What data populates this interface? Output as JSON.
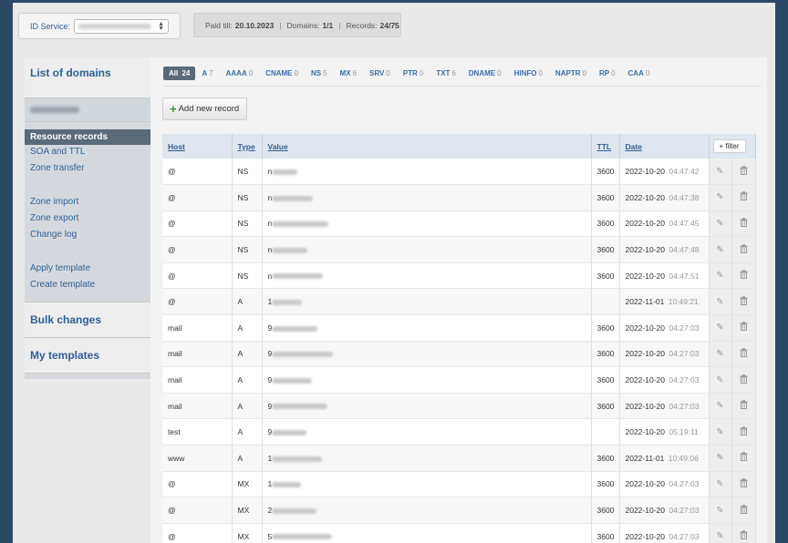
{
  "topbar": {
    "id_service_label": "ID Service:",
    "info": {
      "paid_till_label": "Paid till:",
      "paid_till_value": "20.10.2023",
      "domains_label": "Domains:",
      "domains_value": "1/1",
      "records_label": "Records:",
      "records_value": "24/75"
    }
  },
  "sidebar": {
    "list_of_domains": "List of domains",
    "active_item": "Resource records",
    "menu_group1": [
      "SOA and TTL",
      "Zone transfer"
    ],
    "menu_group2": [
      "Zone import",
      "Zone export",
      "Change log"
    ],
    "menu_group3": [
      "Apply template",
      "Create template"
    ],
    "bulk_changes": "Bulk changes",
    "my_templates": "My templates"
  },
  "filters": [
    {
      "label": "All",
      "count": "24",
      "active": true
    },
    {
      "label": "A",
      "count": "7"
    },
    {
      "label": "AAAA",
      "count": "0"
    },
    {
      "label": "CNAME",
      "count": "0"
    },
    {
      "label": "NS",
      "count": "5"
    },
    {
      "label": "MX",
      "count": "6"
    },
    {
      "label": "SRV",
      "count": "0"
    },
    {
      "label": "PTR",
      "count": "0"
    },
    {
      "label": "TXT",
      "count": "6"
    },
    {
      "label": "DNAME",
      "count": "0"
    },
    {
      "label": "HINFO",
      "count": "0"
    },
    {
      "label": "NAPTR",
      "count": "0"
    },
    {
      "label": "RP",
      "count": "0"
    },
    {
      "label": "CAA",
      "count": "0"
    }
  ],
  "add_record_label": "Add new record",
  "table": {
    "headers": {
      "host": "Host",
      "type": "Type",
      "value": "Value",
      "ttl": "TTL",
      "date": "Date",
      "filter": "+ filter"
    },
    "rows": [
      {
        "host": "@",
        "type": "NS",
        "value_prefix": "n",
        "ttl": "3600",
        "date": "2022-10-20",
        "time": "04:47:42"
      },
      {
        "host": "@",
        "type": "NS",
        "value_prefix": "n",
        "ttl": "3600",
        "date": "2022-10-20",
        "time": "04:47:38"
      },
      {
        "host": "@",
        "type": "NS",
        "value_prefix": "n",
        "ttl": "3600",
        "date": "2022-10-20",
        "time": "04:47:45"
      },
      {
        "host": "@",
        "type": "NS",
        "value_prefix": "n",
        "ttl": "3600",
        "date": "2022-10-20",
        "time": "04:47:48"
      },
      {
        "host": "@",
        "type": "NS",
        "value_prefix": "n",
        "ttl": "3600",
        "date": "2022-10-20",
        "time": "04:47:51"
      },
      {
        "host": "@",
        "type": "A",
        "value_prefix": "1",
        "ttl": "",
        "date": "2022-11-01",
        "time": "10:49:21"
      },
      {
        "host": "mail",
        "type": "A",
        "value_prefix": "9",
        "ttl": "3600",
        "date": "2022-10-20",
        "time": "04:27:03"
      },
      {
        "host": "mail",
        "type": "A",
        "value_prefix": "9",
        "ttl": "3600",
        "date": "2022-10-20",
        "time": "04:27:03"
      },
      {
        "host": "mail",
        "type": "A",
        "value_prefix": "9",
        "ttl": "3600",
        "date": "2022-10-20",
        "time": "04:27:03"
      },
      {
        "host": "mail",
        "type": "A",
        "value_prefix": "9",
        "ttl": "3600",
        "date": "2022-10-20",
        "time": "04:27:03"
      },
      {
        "host": "test",
        "type": "A",
        "value_prefix": "9",
        "ttl": "",
        "date": "2022-10-20",
        "time": "05:19:11"
      },
      {
        "host": "www",
        "type": "A",
        "value_prefix": "1",
        "ttl": "3600",
        "date": "2022-11-01",
        "time": "10:49:06"
      },
      {
        "host": "@",
        "type": "MX",
        "value_prefix": "1",
        "ttl": "3600",
        "date": "2022-10-20",
        "time": "04:27:03"
      },
      {
        "host": "@",
        "type": "MX",
        "value_prefix": "2",
        "ttl": "3600",
        "date": "2022-10-20",
        "time": "04:27:03"
      },
      {
        "host": "@",
        "type": "MX",
        "value_prefix": "5",
        "ttl": "3600",
        "date": "2022-10-20",
        "time": "04:27:03"
      }
    ]
  }
}
